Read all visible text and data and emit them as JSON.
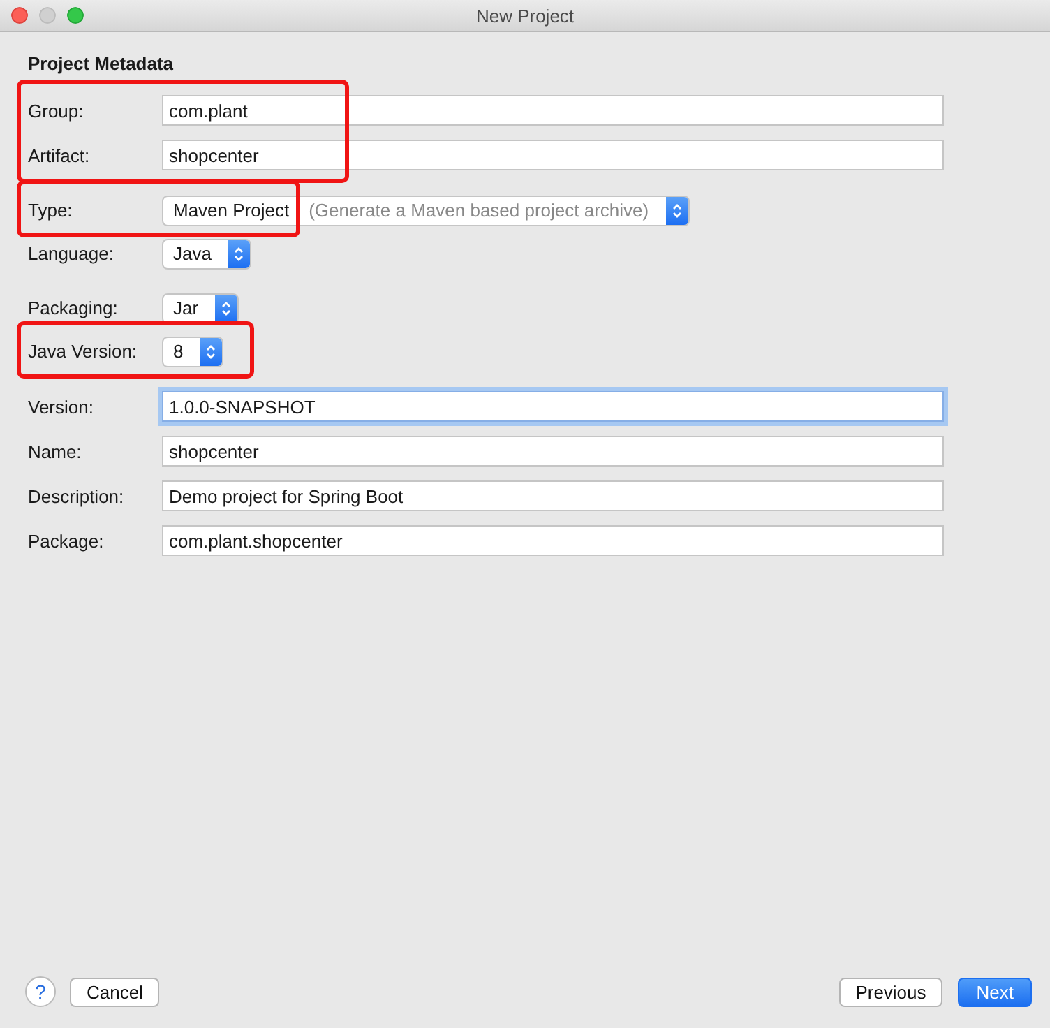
{
  "window": {
    "title": "New Project"
  },
  "section_title": "Project Metadata",
  "fields": [
    {
      "kind": "text",
      "label": "Group:",
      "value": "com.plant",
      "focused": false,
      "highlighted": true
    },
    {
      "kind": "text",
      "label": "Artifact:",
      "value": "shopcenter",
      "focused": false,
      "highlighted": true
    },
    {
      "kind": "select",
      "label": "Type:",
      "value": "Maven Project",
      "hint": "(Generate a Maven based project archive)",
      "highlighted": true
    },
    {
      "kind": "select",
      "label": "Language:",
      "value": "Java",
      "highlighted": false
    },
    {
      "kind": "select",
      "label": "Packaging:",
      "value": "Jar",
      "highlighted": false
    },
    {
      "kind": "select",
      "label": "Java Version:",
      "value": "8",
      "highlighted": true
    },
    {
      "kind": "text",
      "label": "Version:",
      "value": "1.0.0-SNAPSHOT",
      "focused": true,
      "highlighted": false
    },
    {
      "kind": "text",
      "label": "Name:",
      "value": "shopcenter",
      "focused": false,
      "highlighted": false
    },
    {
      "kind": "text",
      "label": "Description:",
      "value": "Demo project for Spring Boot",
      "focused": false,
      "highlighted": false
    },
    {
      "kind": "text",
      "label": "Package:",
      "value": "com.plant.shopcenter",
      "focused": false,
      "highlighted": false
    }
  ],
  "footer": {
    "help": "?",
    "buttons": [
      {
        "label": "Cancel",
        "kind": "normal"
      },
      {
        "label": "Previous",
        "kind": "normal"
      },
      {
        "label": "Next",
        "kind": "default"
      }
    ]
  }
}
